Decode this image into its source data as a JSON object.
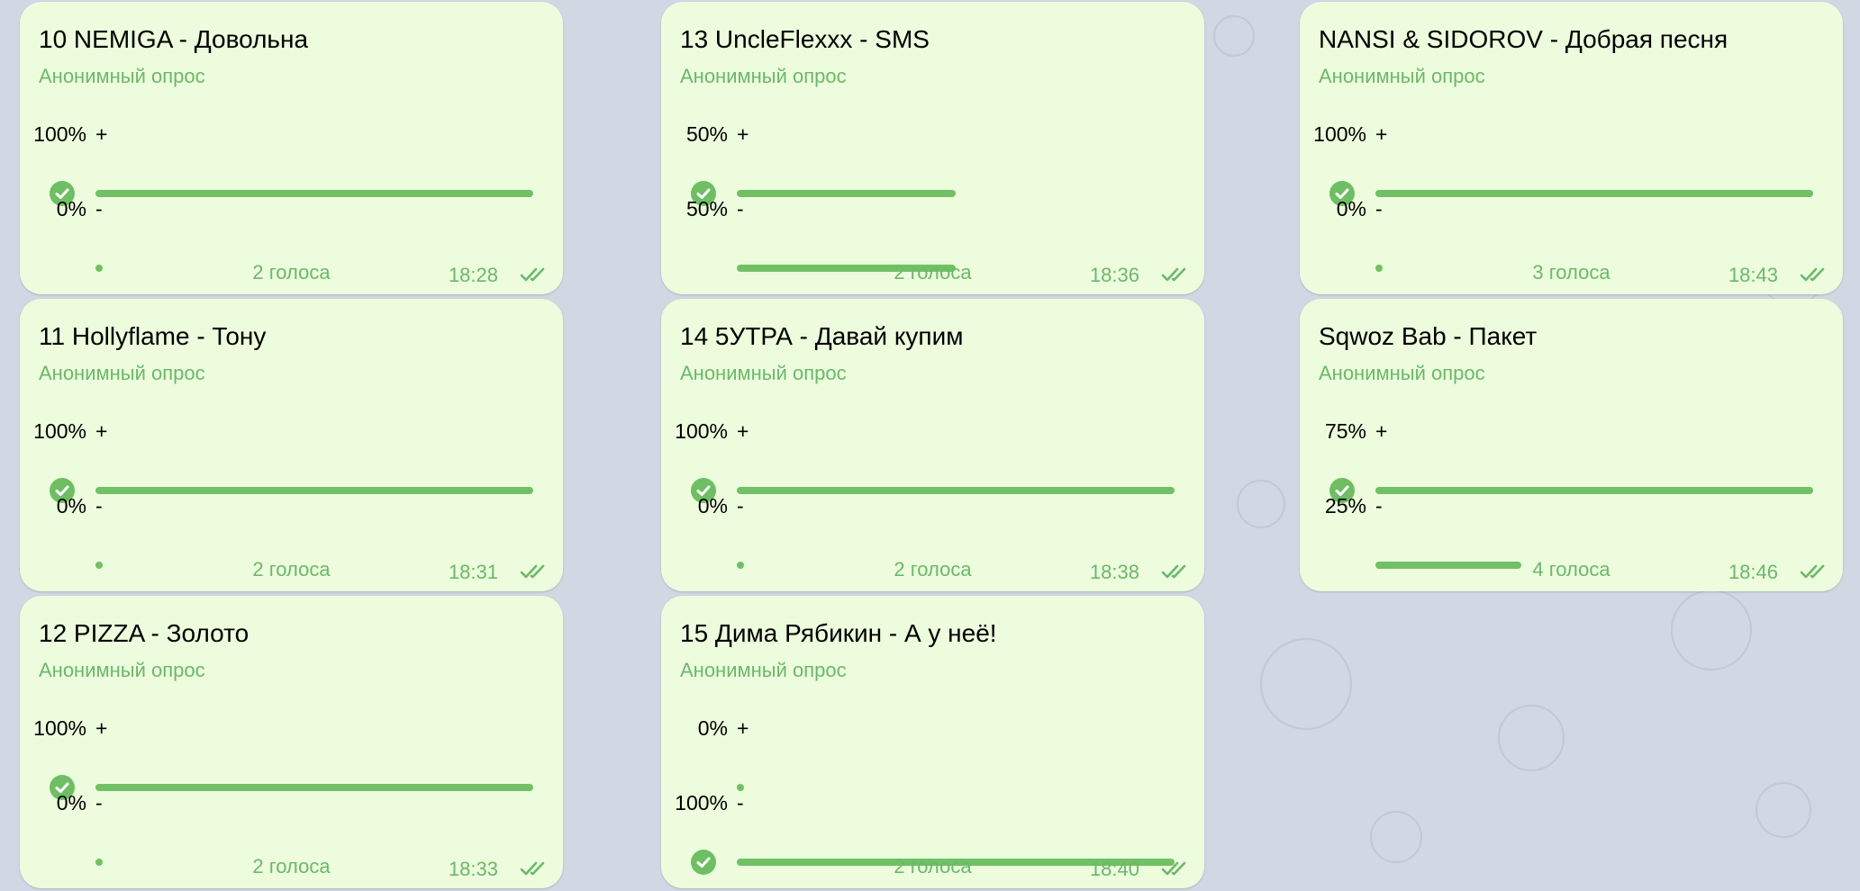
{
  "accent_color": "#72c065",
  "polls": [
    {
      "title": "10 NEMIGA - Довольна",
      "subtitle": "Анонимный опрос",
      "options": [
        {
          "label": "+",
          "percent": "100%",
          "fraction": 1.0,
          "chosen": true
        },
        {
          "label": "-",
          "percent": "0%",
          "fraction": 0.0,
          "chosen": false
        }
      ],
      "votes": "2 голоса",
      "time": "18:28",
      "status_icon": "double-check-icon"
    },
    {
      "title": "13 UncleFlexxx - SMS",
      "subtitle": "Анонимный опрос",
      "options": [
        {
          "label": "+",
          "percent": "50%",
          "fraction": 0.5,
          "chosen": true
        },
        {
          "label": "-",
          "percent": "50%",
          "fraction": 0.5,
          "chosen": false
        }
      ],
      "votes": "2 голоса",
      "time": "18:36",
      "status_icon": "double-check-icon"
    },
    {
      "title": "NANSI & SIDOROV - Добрая песня",
      "subtitle": "Анонимный опрос",
      "options": [
        {
          "label": "+",
          "percent": "100%",
          "fraction": 1.0,
          "chosen": true
        },
        {
          "label": "-",
          "percent": "0%",
          "fraction": 0.0,
          "chosen": false
        }
      ],
      "votes": "3 голоса",
      "time": "18:43",
      "status_icon": "double-check-icon"
    },
    {
      "title": "11 Hollyflame - Тону",
      "subtitle": "Анонимный опрос",
      "options": [
        {
          "label": "+",
          "percent": "100%",
          "fraction": 1.0,
          "chosen": true
        },
        {
          "label": "-",
          "percent": "0%",
          "fraction": 0.0,
          "chosen": false
        }
      ],
      "votes": "2 голоса",
      "time": "18:31",
      "status_icon": "double-check-icon"
    },
    {
      "title": "14 5УТРА - Давай купим",
      "subtitle": "Анонимный опрос",
      "options": [
        {
          "label": "+",
          "percent": "100%",
          "fraction": 1.0,
          "chosen": true
        },
        {
          "label": "-",
          "percent": "0%",
          "fraction": 0.0,
          "chosen": false
        }
      ],
      "votes": "2 голоса",
      "time": "18:38",
      "status_icon": "double-check-icon"
    },
    {
      "title": "Sqwoz Bab - Пакет",
      "subtitle": "Анонимный опрос",
      "options": [
        {
          "label": "+",
          "percent": "75%",
          "fraction": 1.0,
          "chosen": true
        },
        {
          "label": "-",
          "percent": "25%",
          "fraction": 0.333,
          "chosen": false
        }
      ],
      "votes": "4 голоса",
      "time": "18:46",
      "status_icon": "double-check-icon"
    },
    {
      "title": "12 PIZZA - Золото",
      "subtitle": "Анонимный опрос",
      "options": [
        {
          "label": "+",
          "percent": "100%",
          "fraction": 1.0,
          "chosen": true
        },
        {
          "label": "-",
          "percent": "0%",
          "fraction": 0.0,
          "chosen": false
        }
      ],
      "votes": "2 голоса",
      "time": "18:33",
      "status_icon": "double-check-icon"
    },
    {
      "title": "15 Дима Рябикин - А у неё!",
      "subtitle": "Анонимный опрос",
      "options": [
        {
          "label": "+",
          "percent": "0%",
          "fraction": 0.0,
          "chosen": false
        },
        {
          "label": "-",
          "percent": "100%",
          "fraction": 1.0,
          "chosen": true
        }
      ],
      "votes": "2 голоса",
      "time": "18:40",
      "status_icon": "double-check-icon"
    }
  ]
}
